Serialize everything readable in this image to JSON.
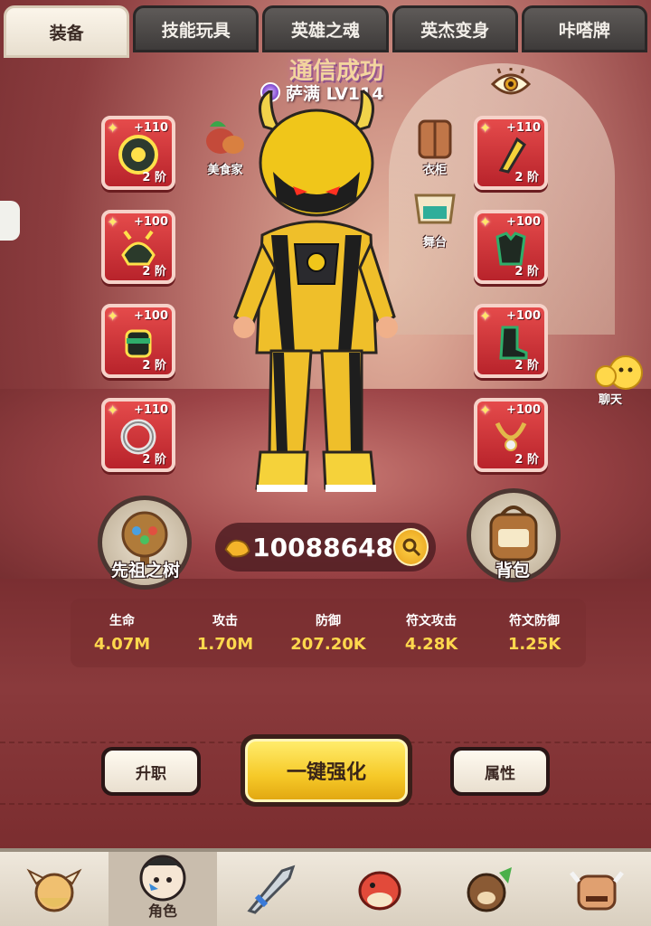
{
  "tabs": [
    {
      "label": "装备",
      "active": true
    },
    {
      "label": "技能玩具",
      "active": false
    },
    {
      "label": "英雄之魂",
      "active": false
    },
    {
      "label": "英杰变身",
      "active": false
    },
    {
      "label": "咔嗒牌",
      "active": false
    }
  ],
  "banner": {
    "text": "通信成功"
  },
  "character": {
    "name": "萨满 LV114"
  },
  "equipment_left": [
    {
      "bonus": "+110",
      "tier": "2 阶",
      "icon": "shield-icon"
    },
    {
      "bonus": "+100",
      "tier": "2 阶",
      "icon": "helmet-icon"
    },
    {
      "bonus": "+100",
      "tier": "2 阶",
      "icon": "glove-icon"
    },
    {
      "bonus": "+110",
      "tier": "2 阶",
      "icon": "ring-icon"
    }
  ],
  "equipment_right": [
    {
      "bonus": "+110",
      "tier": "2 阶",
      "icon": "bracer-icon"
    },
    {
      "bonus": "+100",
      "tier": "2 阶",
      "icon": "armor-icon"
    },
    {
      "bonus": "+100",
      "tier": "2 阶",
      "icon": "boot-icon"
    },
    {
      "bonus": "+100",
      "tier": "2 阶",
      "icon": "necklace-icon"
    }
  ],
  "shortcuts": {
    "gourmet": "美食家",
    "wardrobe": "衣柜",
    "stage": "舞台",
    "chat": "聊天"
  },
  "tree": {
    "label": "先祖之树"
  },
  "bag": {
    "label": "背包"
  },
  "currency": {
    "value": "10088648",
    "icon": "arm-strength-icon"
  },
  "stats": [
    {
      "label": "生命",
      "value": "4.07M"
    },
    {
      "label": "攻击",
      "value": "1.70M"
    },
    {
      "label": "防御",
      "value": "207.20K"
    },
    {
      "label": "符文攻击",
      "value": "4.28K"
    },
    {
      "label": "符文防御",
      "value": "1.25K"
    }
  ],
  "actions": {
    "promote": "升职",
    "enhance_all": "一键强化",
    "attributes": "属性"
  },
  "nav": [
    {
      "label": "",
      "icon": "hero-viking-icon"
    },
    {
      "label": "角色",
      "icon": "character-icon",
      "active": true
    },
    {
      "label": "",
      "icon": "weapon-icon"
    },
    {
      "label": "",
      "icon": "pet-dino-icon"
    },
    {
      "label": "",
      "icon": "guild-bear-icon"
    },
    {
      "label": "",
      "icon": "boss-icon"
    }
  ],
  "colors": {
    "slot_red": "#d8323a",
    "stat_value": "#ffd84d",
    "primary_button": "#f6c928"
  }
}
